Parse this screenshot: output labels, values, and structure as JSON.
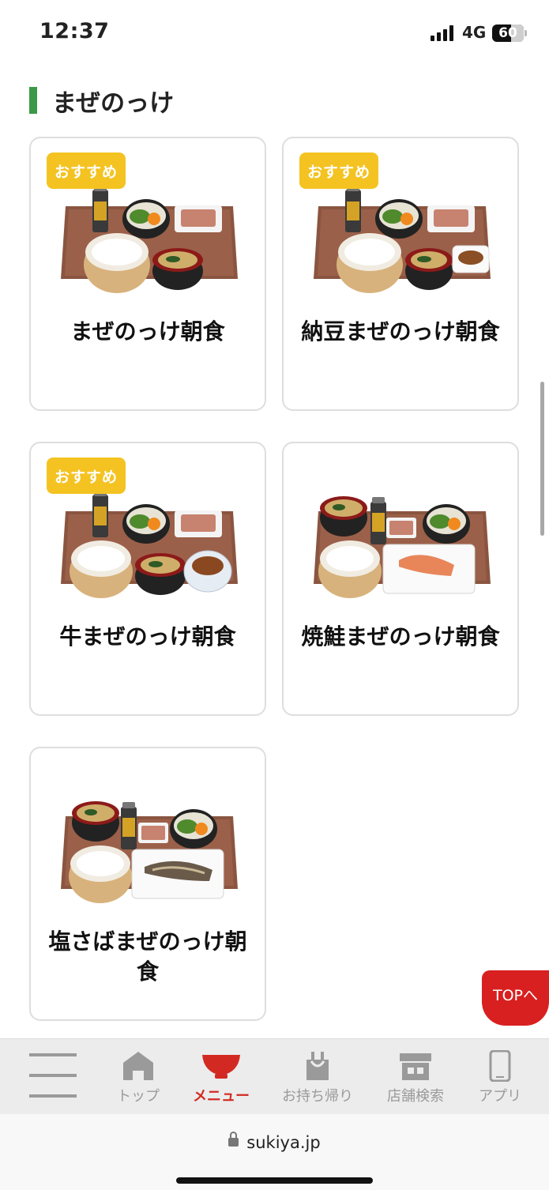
{
  "status": {
    "time": "12:37",
    "network": "4G",
    "battery": "60",
    "battery_level": 0.6
  },
  "section": {
    "title": "まぜのっけ"
  },
  "cards": [
    {
      "title": "まぜのっけ朝食",
      "badge": "おすすめ"
    },
    {
      "title": "納豆まぜのっけ朝食",
      "badge": "おすすめ"
    },
    {
      "title": "牛まぜのっけ朝食",
      "badge": "おすすめ"
    },
    {
      "title": "焼鮭まぜのっけ朝食"
    },
    {
      "title": "塩さばまぜのっけ朝食"
    }
  ],
  "top_button": {
    "label": "TOPへ"
  },
  "nav": {
    "items": [
      {
        "label": "",
        "icon": "hamburger-icon"
      },
      {
        "label": "トップ",
        "icon": "home-icon"
      },
      {
        "label": "メニュー",
        "icon": "bowl-icon",
        "active": true
      },
      {
        "label": "お持ち帰り",
        "icon": "takeout-bag-icon"
      },
      {
        "label": "店舗検索",
        "icon": "store-icon"
      },
      {
        "label": "アプリ",
        "icon": "smartphone-icon"
      }
    ]
  },
  "browser": {
    "url": "sukiya.jp"
  },
  "colors": {
    "accent_green": "#3c9a46",
    "badge_yellow": "#f4c322",
    "brand_red": "#d82020"
  }
}
